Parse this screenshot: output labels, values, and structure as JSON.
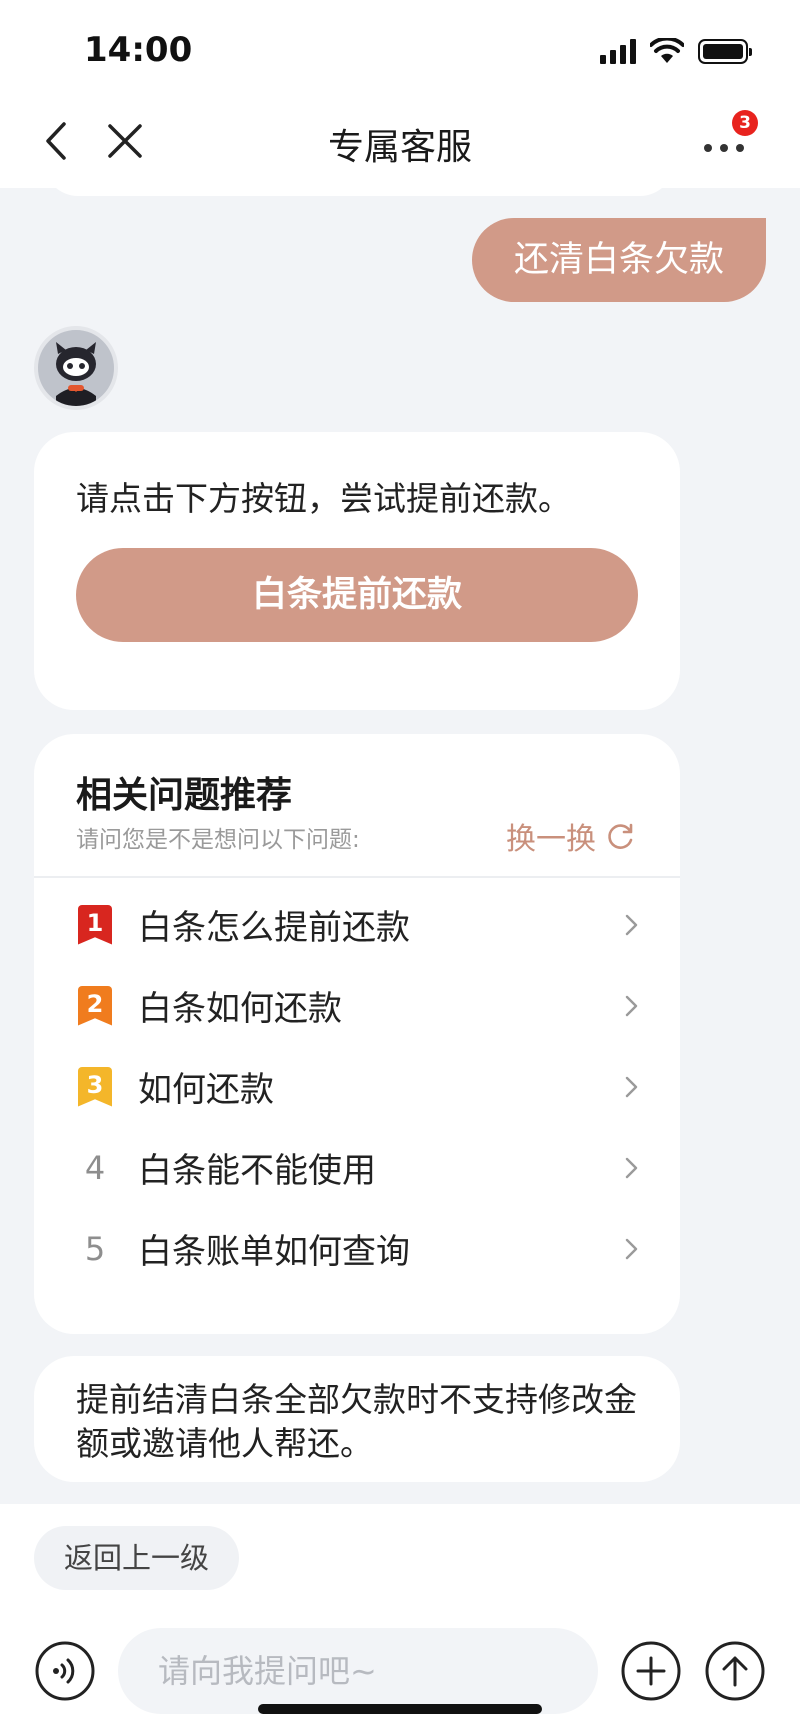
{
  "status_bar": {
    "time": "14:00"
  },
  "nav": {
    "title": "专属客服",
    "badge_count": "3"
  },
  "chat": {
    "user_message": "还清白条欠款",
    "reply_text": "请点击下方按钮，尝试提前还款。",
    "reply_button": "白条提前还款",
    "recommend": {
      "title": "相关问题推荐",
      "subtitle": "请问您是不是想问以下问题:",
      "refresh_label": "换一换",
      "items": [
        {
          "rank": "1",
          "text": "白条怎么提前还款"
        },
        {
          "rank": "2",
          "text": "白条如何还款"
        },
        {
          "rank": "3",
          "text": "如何还款"
        },
        {
          "rank": "4",
          "text": "白条能不能使用"
        },
        {
          "rank": "5",
          "text": "白条账单如何查询"
        }
      ]
    },
    "notice_text": "提前结清白条全部欠款时不支持修改金额或邀请他人帮还。"
  },
  "bottom": {
    "back_label": "返回上一级",
    "input_placeholder": "请向我提问吧~"
  },
  "colors": {
    "accent": "#d19a88",
    "rank1": "#d8261f",
    "rank2": "#f07c1e",
    "rank3": "#f4b62a",
    "badge": "#e8231e"
  }
}
